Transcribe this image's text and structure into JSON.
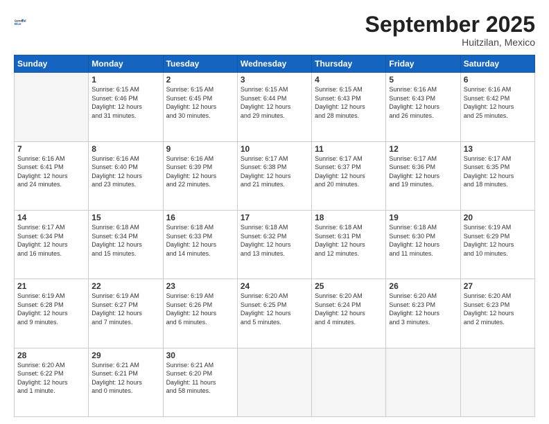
{
  "header": {
    "logo": {
      "general": "General",
      "blue": "Blue"
    },
    "month_title": "September 2025",
    "subtitle": "Huitzilan, Mexico"
  },
  "days_of_week": [
    "Sunday",
    "Monday",
    "Tuesday",
    "Wednesday",
    "Thursday",
    "Friday",
    "Saturday"
  ],
  "weeks": [
    [
      {
        "day": "",
        "info": ""
      },
      {
        "day": "1",
        "info": "Sunrise: 6:15 AM\nSunset: 6:46 PM\nDaylight: 12 hours\nand 31 minutes."
      },
      {
        "day": "2",
        "info": "Sunrise: 6:15 AM\nSunset: 6:45 PM\nDaylight: 12 hours\nand 30 minutes."
      },
      {
        "day": "3",
        "info": "Sunrise: 6:15 AM\nSunset: 6:44 PM\nDaylight: 12 hours\nand 29 minutes."
      },
      {
        "day": "4",
        "info": "Sunrise: 6:15 AM\nSunset: 6:43 PM\nDaylight: 12 hours\nand 28 minutes."
      },
      {
        "day": "5",
        "info": "Sunrise: 6:16 AM\nSunset: 6:43 PM\nDaylight: 12 hours\nand 26 minutes."
      },
      {
        "day": "6",
        "info": "Sunrise: 6:16 AM\nSunset: 6:42 PM\nDaylight: 12 hours\nand 25 minutes."
      }
    ],
    [
      {
        "day": "7",
        "info": "Sunrise: 6:16 AM\nSunset: 6:41 PM\nDaylight: 12 hours\nand 24 minutes."
      },
      {
        "day": "8",
        "info": "Sunrise: 6:16 AM\nSunset: 6:40 PM\nDaylight: 12 hours\nand 23 minutes."
      },
      {
        "day": "9",
        "info": "Sunrise: 6:16 AM\nSunset: 6:39 PM\nDaylight: 12 hours\nand 22 minutes."
      },
      {
        "day": "10",
        "info": "Sunrise: 6:17 AM\nSunset: 6:38 PM\nDaylight: 12 hours\nand 21 minutes."
      },
      {
        "day": "11",
        "info": "Sunrise: 6:17 AM\nSunset: 6:37 PM\nDaylight: 12 hours\nand 20 minutes."
      },
      {
        "day": "12",
        "info": "Sunrise: 6:17 AM\nSunset: 6:36 PM\nDaylight: 12 hours\nand 19 minutes."
      },
      {
        "day": "13",
        "info": "Sunrise: 6:17 AM\nSunset: 6:35 PM\nDaylight: 12 hours\nand 18 minutes."
      }
    ],
    [
      {
        "day": "14",
        "info": "Sunrise: 6:17 AM\nSunset: 6:34 PM\nDaylight: 12 hours\nand 16 minutes."
      },
      {
        "day": "15",
        "info": "Sunrise: 6:18 AM\nSunset: 6:34 PM\nDaylight: 12 hours\nand 15 minutes."
      },
      {
        "day": "16",
        "info": "Sunrise: 6:18 AM\nSunset: 6:33 PM\nDaylight: 12 hours\nand 14 minutes."
      },
      {
        "day": "17",
        "info": "Sunrise: 6:18 AM\nSunset: 6:32 PM\nDaylight: 12 hours\nand 13 minutes."
      },
      {
        "day": "18",
        "info": "Sunrise: 6:18 AM\nSunset: 6:31 PM\nDaylight: 12 hours\nand 12 minutes."
      },
      {
        "day": "19",
        "info": "Sunrise: 6:18 AM\nSunset: 6:30 PM\nDaylight: 12 hours\nand 11 minutes."
      },
      {
        "day": "20",
        "info": "Sunrise: 6:19 AM\nSunset: 6:29 PM\nDaylight: 12 hours\nand 10 minutes."
      }
    ],
    [
      {
        "day": "21",
        "info": "Sunrise: 6:19 AM\nSunset: 6:28 PM\nDaylight: 12 hours\nand 9 minutes."
      },
      {
        "day": "22",
        "info": "Sunrise: 6:19 AM\nSunset: 6:27 PM\nDaylight: 12 hours\nand 7 minutes."
      },
      {
        "day": "23",
        "info": "Sunrise: 6:19 AM\nSunset: 6:26 PM\nDaylight: 12 hours\nand 6 minutes."
      },
      {
        "day": "24",
        "info": "Sunrise: 6:20 AM\nSunset: 6:25 PM\nDaylight: 12 hours\nand 5 minutes."
      },
      {
        "day": "25",
        "info": "Sunrise: 6:20 AM\nSunset: 6:24 PM\nDaylight: 12 hours\nand 4 minutes."
      },
      {
        "day": "26",
        "info": "Sunrise: 6:20 AM\nSunset: 6:23 PM\nDaylight: 12 hours\nand 3 minutes."
      },
      {
        "day": "27",
        "info": "Sunrise: 6:20 AM\nSunset: 6:23 PM\nDaylight: 12 hours\nand 2 minutes."
      }
    ],
    [
      {
        "day": "28",
        "info": "Sunrise: 6:20 AM\nSunset: 6:22 PM\nDaylight: 12 hours\nand 1 minute."
      },
      {
        "day": "29",
        "info": "Sunrise: 6:21 AM\nSunset: 6:21 PM\nDaylight: 12 hours\nand 0 minutes."
      },
      {
        "day": "30",
        "info": "Sunrise: 6:21 AM\nSunset: 6:20 PM\nDaylight: 11 hours\nand 58 minutes."
      },
      {
        "day": "",
        "info": ""
      },
      {
        "day": "",
        "info": ""
      },
      {
        "day": "",
        "info": ""
      },
      {
        "day": "",
        "info": ""
      }
    ]
  ]
}
